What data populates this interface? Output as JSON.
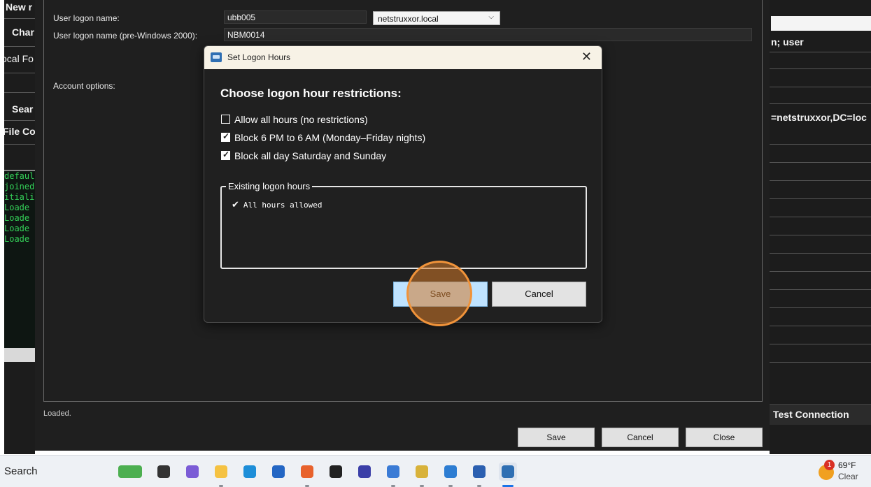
{
  "bg_left": {
    "labels": [
      "New r",
      "Char",
      "ocal Fo",
      "Sear",
      "File Co"
    ],
    "console_lines": [
      "defaul",
      "joined",
      "itiali",
      " Loade",
      " Loade",
      " Loade",
      " Loade"
    ]
  },
  "bg_right": {
    "text_user": "n; user",
    "text_dn": "=netstruxxor,DC=loc",
    "test_connection": "Test Connection"
  },
  "main": {
    "logon_label": "User logon name:",
    "logon_value": "ubb005",
    "domain_value": "netstruxxor.local",
    "prewin_label": "User logon name (pre-Windows 2000):",
    "prewin_value": "NBM0014",
    "account_options_label": "Account options:",
    "status": "Loaded.",
    "save_label": "Save",
    "cancel_label": "Cancel",
    "close_label": "Close"
  },
  "dialog": {
    "title": "Set Logon Hours",
    "heading": "Choose logon hour restrictions:",
    "options": [
      {
        "label": "Allow all hours (no restrictions)",
        "checked": false
      },
      {
        "label": "Block 6 PM to 6 AM (Monday–Friday nights)",
        "checked": true
      },
      {
        "label": "Block all day Saturday and Sunday",
        "checked": true
      }
    ],
    "existing_group_label": "Existing logon hours",
    "existing_items": [
      "All hours allowed"
    ],
    "save_label": "Save",
    "cancel_label": "Cancel"
  },
  "taskbar": {
    "search_label": "Search",
    "icons": [
      {
        "name": "widgets-icon",
        "color": "#4caf50"
      },
      {
        "name": "task-view-icon",
        "color": "#333333"
      },
      {
        "name": "m365-icon",
        "color": "#7b5cd6"
      },
      {
        "name": "file-explorer-icon",
        "color": "#f5c242"
      },
      {
        "name": "edge-icon",
        "color": "#1d8ed8"
      },
      {
        "name": "store-icon",
        "color": "#2366c4"
      },
      {
        "name": "firefox-icon",
        "color": "#e8622c"
      },
      {
        "name": "dropbox-icon",
        "color": "#222222"
      },
      {
        "name": "app-purple-icon",
        "color": "#3b3fa8"
      },
      {
        "name": "remote-icon",
        "color": "#3a7bd5"
      },
      {
        "name": "ticket-icon",
        "color": "#d8b23a"
      },
      {
        "name": "notepad-icon",
        "color": "#2d7dd2"
      },
      {
        "name": "network-icon",
        "color": "#2b5fb0"
      },
      {
        "name": "active-app-icon",
        "color": "#2f6fb3"
      }
    ],
    "weather_badge": "1",
    "weather_temp": "69°F",
    "weather_condition": "Clear"
  }
}
